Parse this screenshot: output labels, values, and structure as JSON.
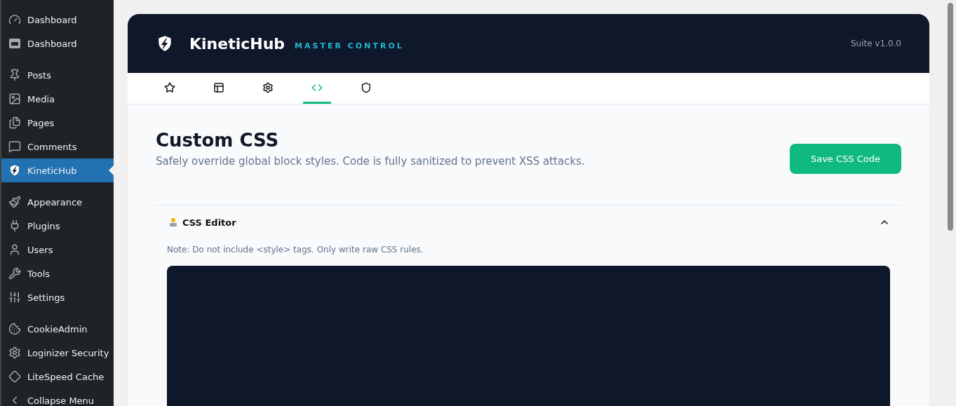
{
  "sidebar": {
    "groups": [
      [
        {
          "label": "Dashboard",
          "selected": false
        },
        {
          "label": "Dashboard",
          "selected": false
        }
      ],
      [
        {
          "label": "Posts",
          "selected": false
        },
        {
          "label": "Media",
          "selected": false
        },
        {
          "label": "Pages",
          "selected": false
        },
        {
          "label": "Comments",
          "selected": false
        },
        {
          "label": "KineticHub",
          "selected": true
        }
      ],
      [
        {
          "label": "Appearance",
          "selected": false
        },
        {
          "label": "Plugins",
          "selected": false
        },
        {
          "label": "Users",
          "selected": false
        },
        {
          "label": "Tools",
          "selected": false
        },
        {
          "label": "Settings",
          "selected": false
        }
      ],
      [
        {
          "label": "CookieAdmin",
          "selected": false
        },
        {
          "label": "Loginizer Security",
          "selected": false
        },
        {
          "label": "LiteSpeed Cache",
          "selected": false
        },
        {
          "label": "Collapse Menu",
          "selected": false
        }
      ]
    ]
  },
  "header": {
    "brand": "KineticHub",
    "tagline": "MASTER CONTROL",
    "version": "Suite v1.0.0"
  },
  "tabs": [
    {
      "selected": false
    },
    {
      "selected": false
    },
    {
      "selected": false
    },
    {
      "selected": true
    },
    {
      "selected": false
    }
  ],
  "page": {
    "title": "Custom CSS",
    "subtitle": "Safely override global block styles. Code is fully sanitized to prevent XSS attacks.",
    "save_button": "Save CSS Code"
  },
  "editor": {
    "title": "CSS Editor",
    "expanded": true,
    "note": "Note: Do not include <style> tags. Only write raw CSS rules."
  }
}
